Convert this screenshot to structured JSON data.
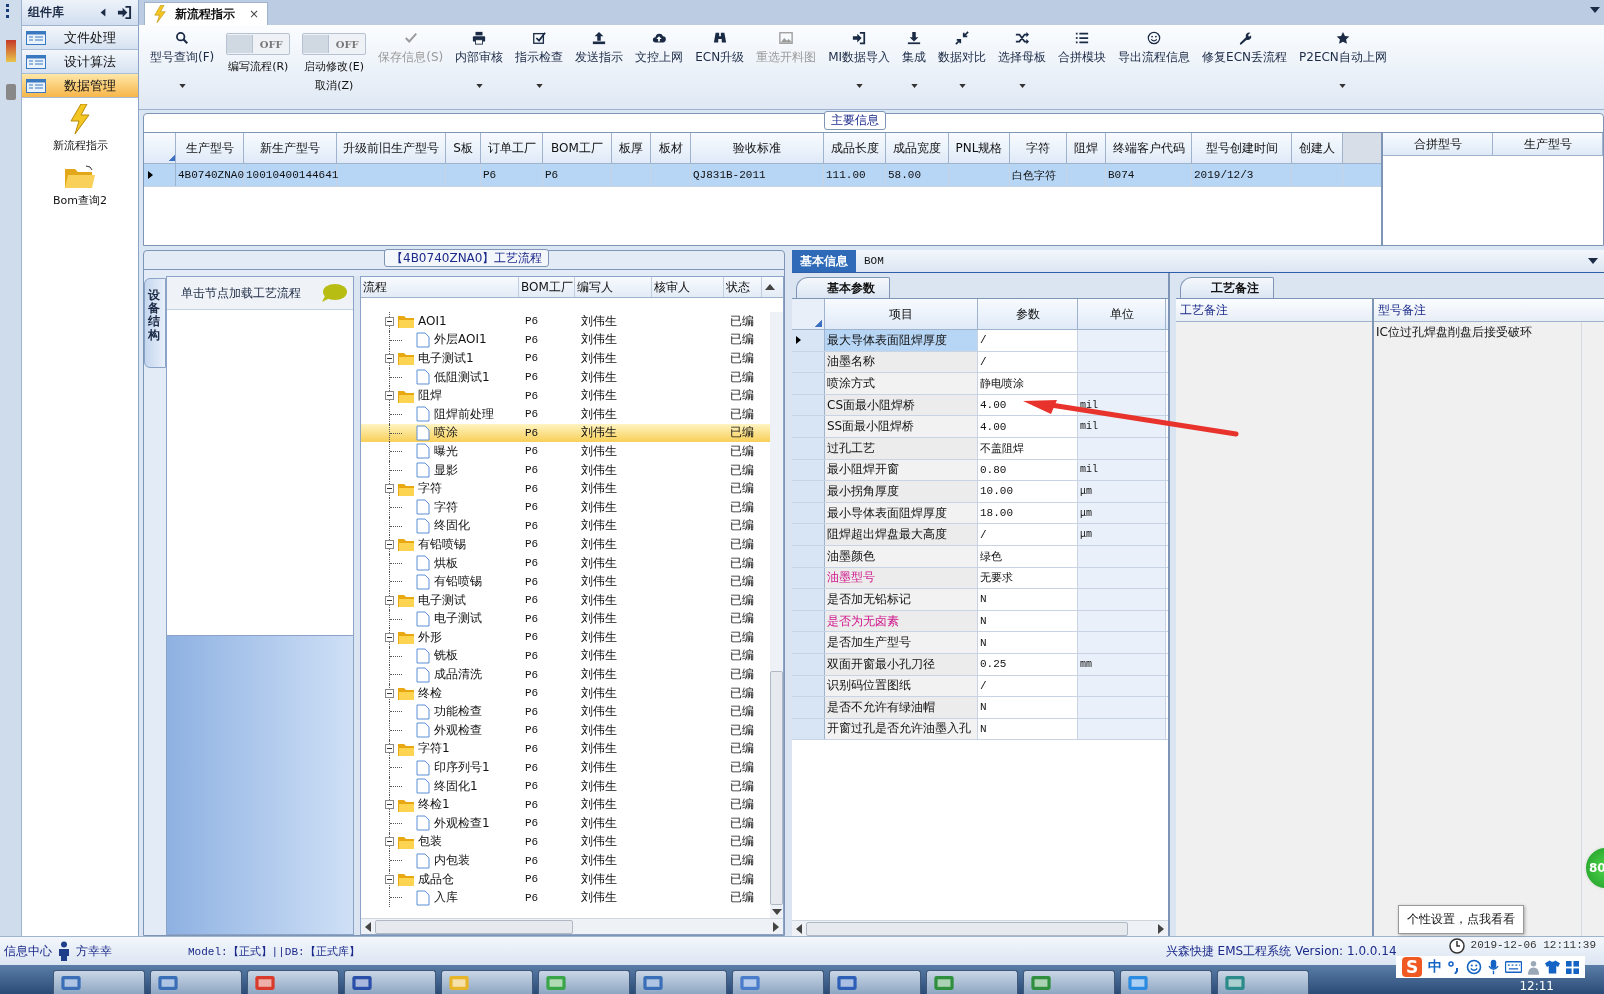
{
  "sidebar": {
    "title": "组件库",
    "items": [
      {
        "label": "文件处理",
        "selected": false
      },
      {
        "label": "设计算法",
        "selected": false
      },
      {
        "label": "数据管理",
        "selected": true
      }
    ],
    "shortcuts": [
      {
        "label": "新流程指示",
        "kind": "lightning"
      },
      {
        "label": "Bom查询2",
        "kind": "folder"
      }
    ]
  },
  "document_tab": {
    "title": "新流程指示",
    "close": "×",
    "selected": true
  },
  "toolbar": [
    {
      "kind": "search",
      "label": "型号查询(F)",
      "disabled": false,
      "dropdown": true
    },
    {
      "kind": "toggle",
      "label": "编写流程(R)",
      "switch_text": "OFF",
      "on": false
    },
    {
      "kind": "toggle",
      "label": "启动修改(E)",
      "second_label": "取消(Z)",
      "switch_text": "OFF",
      "on": false
    },
    {
      "kind": "check",
      "label": "保存信息(S)",
      "disabled": true,
      "dropdown": false
    },
    {
      "kind": "printer",
      "label": "内部审核",
      "disabled": false,
      "dropdown": true
    },
    {
      "kind": "checkbox",
      "label": "指示检查",
      "disabled": false,
      "dropdown": true
    },
    {
      "kind": "upload",
      "label": "发送指示",
      "disabled": false,
      "dropdown": false
    },
    {
      "kind": "cloud",
      "label": "文控上网",
      "disabled": false,
      "dropdown": false
    },
    {
      "kind": "binoculars",
      "label": "ECN升级",
      "disabled": false,
      "dropdown": false
    },
    {
      "kind": "image",
      "label": "重选开料图",
      "disabled": true,
      "dropdown": false
    },
    {
      "kind": "import",
      "label": "MI数据导入",
      "disabled": false,
      "dropdown": true
    },
    {
      "kind": "download",
      "label": "集成",
      "disabled": false,
      "dropdown": true
    },
    {
      "kind": "compress",
      "label": "数据对比",
      "disabled": false,
      "dropdown": true
    },
    {
      "kind": "shuffle",
      "label": "选择母板",
      "disabled": false,
      "dropdown": true
    },
    {
      "kind": "list",
      "label": "合拼模块",
      "disabled": false,
      "dropdown": false
    },
    {
      "kind": "smiley",
      "label": "导出流程信息",
      "disabled": false,
      "dropdown": false
    },
    {
      "kind": "wrench",
      "label": "修复ECN丢流程",
      "disabled": false,
      "dropdown": false
    },
    {
      "kind": "star",
      "label": "P2ECN自动上网",
      "disabled": false,
      "dropdown": true
    }
  ],
  "main_info": {
    "title": "主要信息",
    "columns": [
      "生产型号",
      "新生产型号",
      "升级前旧生产型号",
      "S板",
      "订单工厂",
      "BOM工厂",
      "板厚",
      "板材",
      "验收标准",
      "成品长度",
      "成品宽度",
      "PNL规格",
      "字符",
      "阻焊",
      "终端客户代码",
      "型号创建时间",
      "创建人"
    ],
    "rows": [
      {
        "selected": true,
        "cells": [
          "4B0740ZNA0",
          "10010400144641",
          null,
          null,
          "P6",
          "P6",
          null,
          null,
          "QJ831B-2011",
          "111.00",
          "58.00",
          null,
          "白色字符",
          null,
          "B074",
          "2019/12/3",
          null
        ]
      }
    ],
    "side_columns": [
      "合拼型号",
      "生产型号"
    ]
  },
  "equipment_panel": {
    "tab": "设备结构",
    "hint": "单击节点加载工艺流程"
  },
  "process_tree": {
    "title": "【4B0740ZNA0】工艺流程",
    "columns": [
      "流程",
      "BOM工厂",
      "编写人",
      "核审人",
      "状态"
    ],
    "nodes": [
      {
        "name": "AOI1",
        "bom": "P6",
        "writer": "刘伟生",
        "status": "已编",
        "expanded": true,
        "children": [
          {
            "name": "外层AOI1",
            "bom": "P6",
            "writer": "刘伟生",
            "status": "已编",
            "selected": false
          }
        ]
      },
      {
        "name": "电子测试1",
        "bom": "P6",
        "writer": "刘伟生",
        "status": "已编",
        "expanded": true,
        "children": [
          {
            "name": "低阻测试1",
            "bom": "P6",
            "writer": "刘伟生",
            "status": "已编",
            "selected": false
          }
        ]
      },
      {
        "name": "阻焊",
        "bom": "P6",
        "writer": "刘伟生",
        "status": "已编",
        "expanded": true,
        "children": [
          {
            "name": "阻焊前处理",
            "bom": "P6",
            "writer": "刘伟生",
            "status": "已编",
            "selected": false
          },
          {
            "name": "喷涂",
            "bom": "P6",
            "writer": "刘伟生",
            "status": "已编",
            "selected": true
          },
          {
            "name": "曝光",
            "bom": "P6",
            "writer": "刘伟生",
            "status": "已编",
            "selected": false
          },
          {
            "name": "显影",
            "bom": "P6",
            "writer": "刘伟生",
            "status": "已编",
            "selected": false
          }
        ]
      },
      {
        "name": "字符",
        "bom": "P6",
        "writer": "刘伟生",
        "status": "已编",
        "expanded": true,
        "children": [
          {
            "name": "字符",
            "bom": "P6",
            "writer": "刘伟生",
            "status": "已编",
            "selected": false
          },
          {
            "name": "终固化",
            "bom": "P6",
            "writer": "刘伟生",
            "status": "已编",
            "selected": false
          }
        ]
      },
      {
        "name": "有铅喷锡",
        "bom": "P6",
        "writer": "刘伟生",
        "status": "已编",
        "expanded": true,
        "children": [
          {
            "name": "烘板",
            "bom": "P6",
            "writer": "刘伟生",
            "status": "已编",
            "selected": false
          },
          {
            "name": "有铅喷锡",
            "bom": "P6",
            "writer": "刘伟生",
            "status": "已编",
            "selected": false
          }
        ]
      },
      {
        "name": "电子测试",
        "bom": "P6",
        "writer": "刘伟生",
        "status": "已编",
        "expanded": true,
        "children": [
          {
            "name": "电子测试",
            "bom": "P6",
            "writer": "刘伟生",
            "status": "已编",
            "selected": false
          }
        ]
      },
      {
        "name": "外形",
        "bom": "P6",
        "writer": "刘伟生",
        "status": "已编",
        "expanded": true,
        "children": [
          {
            "name": "铣板",
            "bom": "P6",
            "writer": "刘伟生",
            "status": "已编",
            "selected": false
          },
          {
            "name": "成品清洗",
            "bom": "P6",
            "writer": "刘伟生",
            "status": "已编",
            "selected": false
          }
        ]
      },
      {
        "name": "终检",
        "bom": "P6",
        "writer": "刘伟生",
        "status": "已编",
        "expanded": true,
        "children": [
          {
            "name": "功能检查",
            "bom": "P6",
            "writer": "刘伟生",
            "status": "已编",
            "selected": false
          },
          {
            "name": "外观检查",
            "bom": "P6",
            "writer": "刘伟生",
            "status": "已编",
            "selected": false
          }
        ]
      },
      {
        "name": "字符1",
        "bom": "P6",
        "writer": "刘伟生",
        "status": "已编",
        "expanded": true,
        "children": [
          {
            "name": "印序列号1",
            "bom": "P6",
            "writer": "刘伟生",
            "status": "已编",
            "selected": false
          },
          {
            "name": "终固化1",
            "bom": "P6",
            "writer": "刘伟生",
            "status": "已编",
            "selected": false
          }
        ]
      },
      {
        "name": "终检1",
        "bom": "P6",
        "writer": "刘伟生",
        "status": "已编",
        "expanded": true,
        "children": [
          {
            "name": "外观检查1",
            "bom": "P6",
            "writer": "刘伟生",
            "status": "已编",
            "selected": false
          }
        ]
      },
      {
        "name": "包装",
        "bom": "P6",
        "writer": "刘伟生",
        "status": "已编",
        "expanded": true,
        "children": [
          {
            "name": "内包装",
            "bom": "P6",
            "writer": "刘伟生",
            "status": "已编",
            "selected": false
          }
        ]
      },
      {
        "name": "成品仓",
        "bom": "P6",
        "writer": "刘伟生",
        "status": "已编",
        "expanded": true,
        "children": [
          {
            "name": "入库",
            "bom": "P6",
            "writer": "刘伟生",
            "status": "已编",
            "selected": false
          }
        ]
      }
    ]
  },
  "detail_tabs": [
    {
      "label": "基本信息",
      "selected": true
    },
    {
      "label": "BOM",
      "selected": false
    }
  ],
  "params": {
    "tab": "基本参数",
    "columns": [
      "项目",
      "参数",
      "单位"
    ],
    "rows": [
      {
        "item": "最大导体表面阻焊厚度",
        "value": "/",
        "selected": true,
        "emphasized": false
      },
      {
        "item": "油墨名称",
        "value": "/",
        "selected": false,
        "emphasized": false
      },
      {
        "item": "喷涂方式",
        "value": "静电喷涂",
        "selected": false,
        "emphasized": false
      },
      {
        "item": "CS面最小阻焊桥",
        "value": "4.00",
        "unit": "mil",
        "selected": false,
        "emphasized": false
      },
      {
        "item": "SS面最小阻焊桥",
        "value": "4.00",
        "unit": "mil",
        "selected": false,
        "emphasized": false
      },
      {
        "item": "过孔工艺",
        "value": "不盖阻焊",
        "selected": false,
        "emphasized": false
      },
      {
        "item": "最小阻焊开窗",
        "value": "0.80",
        "unit": "mil",
        "selected": false,
        "emphasized": false
      },
      {
        "item": "最小拐角厚度",
        "value": "10.00",
        "unit": "μm",
        "selected": false,
        "emphasized": false
      },
      {
        "item": "最小导体表面阻焊厚度",
        "value": "18.00",
        "unit": "μm",
        "selected": false,
        "emphasized": false
      },
      {
        "item": "阻焊超出焊盘最大高度",
        "value": "/",
        "unit": "μm",
        "selected": false,
        "emphasized": false
      },
      {
        "item": "油墨颜色",
        "value": "绿色",
        "selected": false,
        "emphasized": false
      },
      {
        "item": "油墨型号",
        "value": "无要求",
        "selected": false,
        "emphasized": true
      },
      {
        "item": "是否加无铅标记",
        "value": "N",
        "selected": false,
        "emphasized": false
      },
      {
        "item": "是否为无卤素",
        "value": "N",
        "selected": false,
        "emphasized": true
      },
      {
        "item": "是否加生产型号",
        "value": "N",
        "selected": false,
        "emphasized": false
      },
      {
        "item": "双面开窗最小孔刀径",
        "value": "0.25",
        "unit": "mm",
        "selected": false,
        "emphasized": false
      },
      {
        "item": "识别码位置图纸",
        "value": "/",
        "selected": false,
        "emphasized": false
      },
      {
        "item": "是否不允许有绿油帽",
        "value": "N",
        "selected": false,
        "emphasized": false
      },
      {
        "item": "开窗过孔是否允许油墨入孔",
        "value": "N",
        "selected": false,
        "emphasized": false
      }
    ]
  },
  "notes": {
    "tab": "工艺备注",
    "columns": [
      "工艺备注",
      "型号备注"
    ],
    "model_note": "IC位过孔焊盘削盘后接受破环"
  },
  "status_bar": {
    "label": "信息中心",
    "user": "方幸幸",
    "model": "Model:【正式】||DB:【正式库】",
    "system": "兴森快捷 EMS工程系统 Version: 1.0.0.14",
    "datetime": "2019-12-06 12:11:39"
  },
  "tooltip": "个性设置，点我看看",
  "ime_bar": {
    "logo": "S",
    "mode": "中"
  },
  "floating_badge": "80",
  "taskbar": {
    "buttons": [
      {
        "kind": "window"
      },
      {
        "kind": "window"
      },
      {
        "kind": "swoosh"
      },
      {
        "kind": "disk"
      },
      {
        "kind": "sun"
      },
      {
        "kind": "green"
      },
      {
        "kind": "window"
      },
      {
        "kind": "list"
      },
      {
        "kind": "word"
      },
      {
        "kind": "excel"
      },
      {
        "kind": "excel"
      },
      {
        "kind": "send"
      },
      {
        "kind": "cam"
      }
    ],
    "clock": "12:11"
  }
}
